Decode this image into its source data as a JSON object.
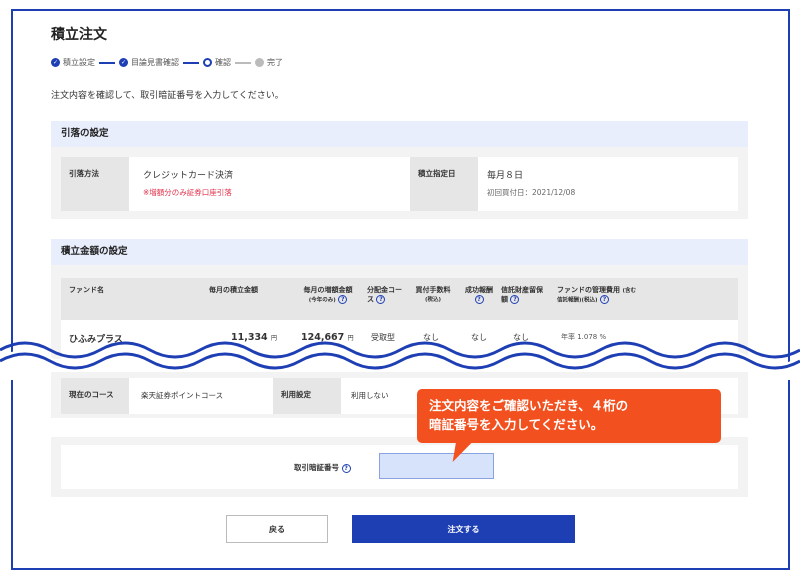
{
  "page": {
    "title": "積立注文",
    "instruction": "注文内容を確認して、取引暗証番号を入力してください。"
  },
  "steps": [
    {
      "label": "積立設定",
      "state": "done"
    },
    {
      "label": "目論見書確認",
      "state": "done"
    },
    {
      "label": "確認",
      "state": "current"
    },
    {
      "label": "完了",
      "state": "future"
    }
  ],
  "withdrawal": {
    "heading": "引落の設定",
    "method_label": "引落方法",
    "method_value": "クレジットカード決済",
    "method_note": "※増額分のみ証券口座引落",
    "date_label": "積立指定日",
    "date_value": "毎月８日",
    "date_note": "初回買付日：2021/12/08"
  },
  "amount": {
    "heading": "積立金額の設定",
    "headers": {
      "fund": "ファンド名",
      "monthly": "毎月の積立金額",
      "increase": "毎月の増額金額",
      "increase_sub": "(今年のみ)",
      "dividend": "分配金コース",
      "fee": "買付手数料",
      "fee_sub": "(税込)",
      "reward": "成功報酬",
      "custody": "信託財産留保額",
      "mgmt": "ファンドの管理費用",
      "mgmt_sub": "(含む信託報酬)(税込)"
    },
    "row": {
      "fund": "ひふみプラス",
      "monthly": "11,334",
      "monthly_unit": "円",
      "increase": "124,667",
      "increase_unit": "円",
      "dividend": "受取型",
      "fee": "なし",
      "reward": "なし",
      "custody": "なし",
      "mgmt": "年率 1.078 %"
    }
  },
  "course": {
    "label": "現在のコース",
    "value": "楽天証券ポイントコース",
    "use_label": "利用設定",
    "use_value": "利用しない"
  },
  "pin": {
    "label": "取引暗証番号",
    "value": ""
  },
  "callout": {
    "line1": "注文内容をご確認いただき、４桁の",
    "line2": "暗証番号を入力してください。"
  },
  "buttons": {
    "back": "戻る",
    "order": "注文する"
  },
  "colors": {
    "accent": "#1e3fb4",
    "callout": "#f2501e",
    "note_red": "#e0304b",
    "panel_head": "#e8eefc"
  }
}
